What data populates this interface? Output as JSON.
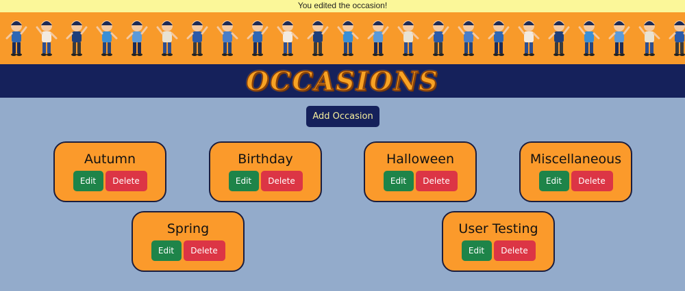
{
  "flash": {
    "message": "You edited the occasion!"
  },
  "banner": {
    "image": "children-illustration-banner"
  },
  "header": {
    "title": "OCCASIONS"
  },
  "actions": {
    "add_label": "Add Occasion"
  },
  "occasions": [
    {
      "name": "Autumn",
      "edit_label": "Edit",
      "delete_label": "Delete"
    },
    {
      "name": "Birthday",
      "edit_label": "Edit",
      "delete_label": "Delete"
    },
    {
      "name": "Halloween",
      "edit_label": "Edit",
      "delete_label": "Delete"
    },
    {
      "name": "Miscellaneous",
      "edit_label": "Edit",
      "delete_label": "Delete"
    },
    {
      "name": "Spring",
      "edit_label": "Edit",
      "delete_label": "Delete"
    },
    {
      "name": "User Testing",
      "edit_label": "Edit",
      "delete_label": "Delete"
    }
  ],
  "colors": {
    "background": "#93abcb",
    "banner": "#f89a2a",
    "header": "#15215b",
    "card": "#fb9a2b",
    "edit": "#1e8449",
    "delete": "#dc3545",
    "flash": "#fbf799"
  }
}
